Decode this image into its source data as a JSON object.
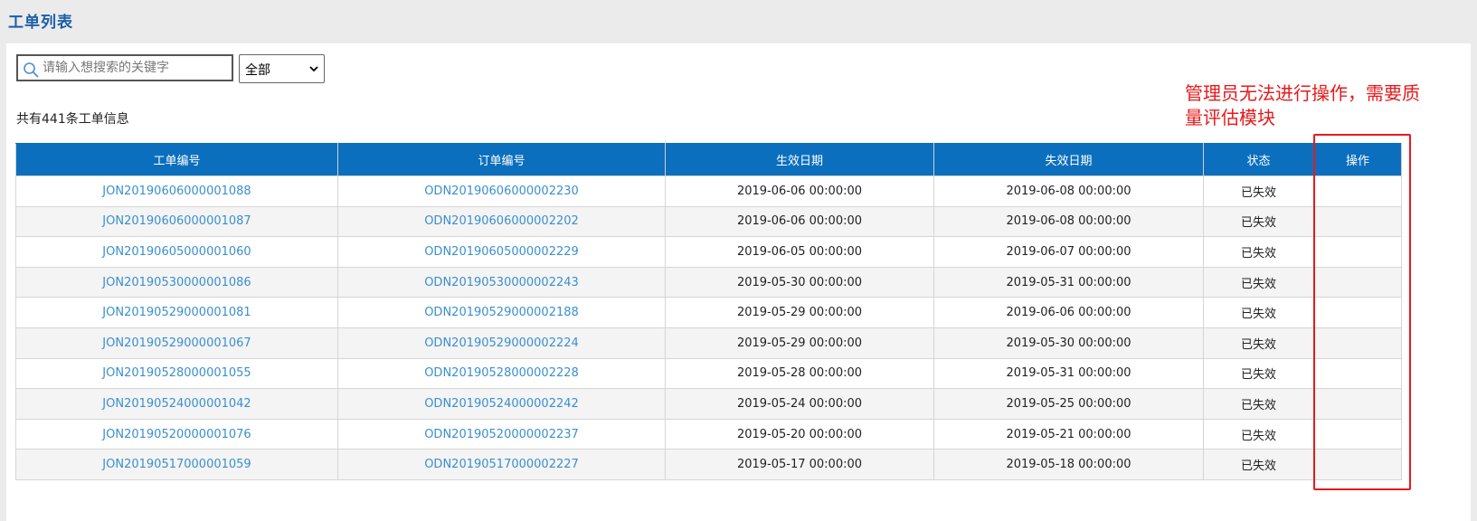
{
  "header": {
    "title": "工单列表"
  },
  "search": {
    "placeholder": "请输入想搜索的关键字",
    "value": ""
  },
  "filter": {
    "selected": "全部"
  },
  "summary": {
    "count_text": "共有441条工单信息"
  },
  "annotation": {
    "note": "管理员无法进行操作，需要质量评估模块",
    "color": "#e8191b"
  },
  "colors": {
    "header_bg": "#0b6fbd",
    "link": "#3a8fd0",
    "title": "#1a5fa8"
  },
  "table": {
    "columns": [
      "工单编号",
      "订单编号",
      "生效日期",
      "失效日期",
      "状态",
      "操作"
    ],
    "rows": [
      {
        "job_no": "JON20190606000001088",
        "order_no": "ODN20190606000002230",
        "start": "2019-06-06 00:00:00",
        "end": "2019-06-08 00:00:00",
        "status": "已失效",
        "action": ""
      },
      {
        "job_no": "JON20190606000001087",
        "order_no": "ODN20190606000002202",
        "start": "2019-06-06 00:00:00",
        "end": "2019-06-08 00:00:00",
        "status": "已失效",
        "action": ""
      },
      {
        "job_no": "JON20190605000001060",
        "order_no": "ODN20190605000002229",
        "start": "2019-06-05 00:00:00",
        "end": "2019-06-07 00:00:00",
        "status": "已失效",
        "action": ""
      },
      {
        "job_no": "JON20190530000001086",
        "order_no": "ODN20190530000002243",
        "start": "2019-05-30 00:00:00",
        "end": "2019-05-31 00:00:00",
        "status": "已失效",
        "action": ""
      },
      {
        "job_no": "JON20190529000001081",
        "order_no": "ODN20190529000002188",
        "start": "2019-05-29 00:00:00",
        "end": "2019-06-06 00:00:00",
        "status": "已失效",
        "action": ""
      },
      {
        "job_no": "JON20190529000001067",
        "order_no": "ODN20190529000002224",
        "start": "2019-05-29 00:00:00",
        "end": "2019-05-30 00:00:00",
        "status": "已失效",
        "action": ""
      },
      {
        "job_no": "JON20190528000001055",
        "order_no": "ODN20190528000002228",
        "start": "2019-05-28 00:00:00",
        "end": "2019-05-31 00:00:00",
        "status": "已失效",
        "action": ""
      },
      {
        "job_no": "JON20190524000001042",
        "order_no": "ODN20190524000002242",
        "start": "2019-05-24 00:00:00",
        "end": "2019-05-25 00:00:00",
        "status": "已失效",
        "action": ""
      },
      {
        "job_no": "JON20190520000001076",
        "order_no": "ODN20190520000002237",
        "start": "2019-05-20 00:00:00",
        "end": "2019-05-21 00:00:00",
        "status": "已失效",
        "action": ""
      },
      {
        "job_no": "JON20190517000001059",
        "order_no": "ODN20190517000002227",
        "start": "2019-05-17 00:00:00",
        "end": "2019-05-18 00:00:00",
        "status": "已失效",
        "action": ""
      }
    ]
  }
}
